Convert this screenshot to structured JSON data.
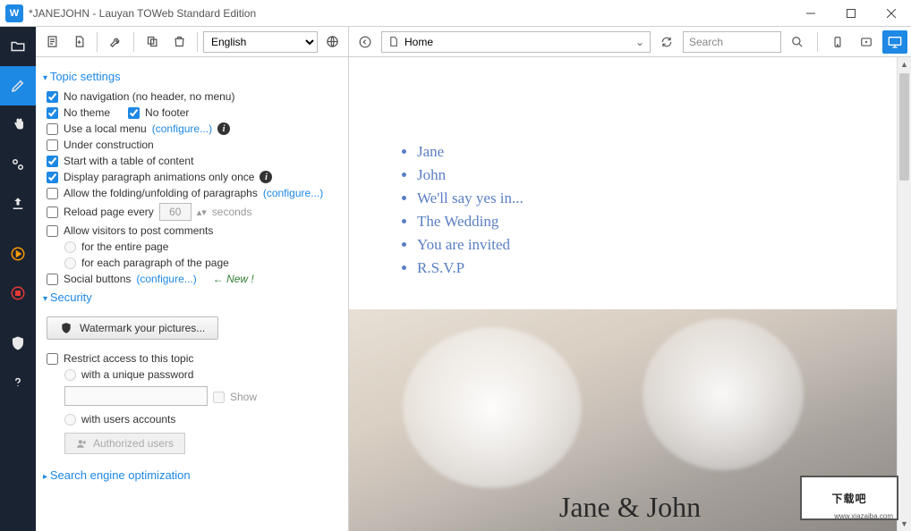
{
  "titlebar": {
    "title": "*JANEJOHN - Lauyan TOWeb Standard Edition"
  },
  "stoolbar": {
    "lang_options": [
      "English"
    ],
    "lang_selected": "English"
  },
  "settings": {
    "sections": {
      "topic": "Topic settings",
      "security": "Security",
      "seo": "Search engine optimization"
    },
    "no_navigation": "No navigation (no header, no menu)",
    "no_theme": "No theme",
    "no_footer": "No footer",
    "local_menu": "Use a local menu",
    "configure": "(configure...)",
    "under_construction": "Under construction",
    "start_toc": "Start with a table of content",
    "para_anim": "Display paragraph animations only once",
    "folding": "Allow the folding/unfolding of paragraphs",
    "reload": "Reload page every",
    "reload_val": "60",
    "seconds": "seconds",
    "comments": "Allow visitors to post comments",
    "entire_page": "for the entire page",
    "each_para": "for each paragraph of the page",
    "social": "Social buttons",
    "new": "←  New !",
    "watermark_btn": "Watermark your pictures...",
    "restrict": "Restrict access to this topic",
    "unique_pw": "with a unique password",
    "show": "Show",
    "users_acc": "with users accounts",
    "auth_users": "Authorized users"
  },
  "ptoolbar": {
    "addr": "Home",
    "search_ph": "Search"
  },
  "preview": {
    "toc": [
      "Jane",
      "John",
      "We'll say yes in...",
      "The Wedding",
      "You are invited",
      "R.S.V.P"
    ],
    "hero_title": "Jane & John"
  },
  "watermark": {
    "main": "下载吧",
    "url": "www.xiazaiba.com"
  }
}
